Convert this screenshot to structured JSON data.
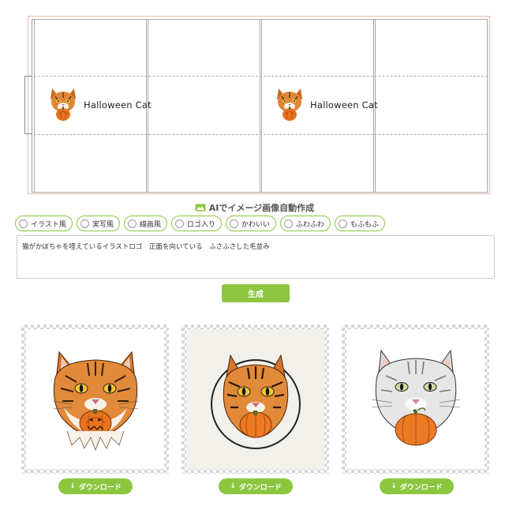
{
  "sheet": {
    "labels": [
      {
        "text": "Halloween Cat"
      },
      {
        "text": "Halloween Cat"
      }
    ]
  },
  "ai_section": {
    "heading": "AIでイメージ画像自動作成",
    "styles": [
      {
        "label": "イラスト風",
        "selected": false
      },
      {
        "label": "実写風",
        "selected": false
      },
      {
        "label": "線画風",
        "selected": false
      },
      {
        "label": "ロゴ入り",
        "selected": false
      },
      {
        "label": "かわいい",
        "selected": false
      },
      {
        "label": "ふわふわ",
        "selected": false
      },
      {
        "label": "もふもふ",
        "selected": false
      }
    ],
    "prompt_value": "猫がかぼちゃを咥えているイラストロゴ　正面を向いている　ふさふさした毛並み",
    "generate_label": "生成"
  },
  "results": [
    {
      "name": "tabby-cat-pumpkin-face",
      "download_label": "ダウンロード"
    },
    {
      "name": "tabby-cat-pumpkin-circle",
      "download_label": "ダウンロード"
    },
    {
      "name": "silver-cat-pumpkin",
      "download_label": "ダウンロード"
    }
  ],
  "colors": {
    "accent": "#8cc63f",
    "sheet_border": "#e8b9a8",
    "pumpkin": "#e8731e",
    "tabby": "#d9782a"
  },
  "icons": {
    "download": "down-arrow",
    "heading": "image-icon"
  }
}
